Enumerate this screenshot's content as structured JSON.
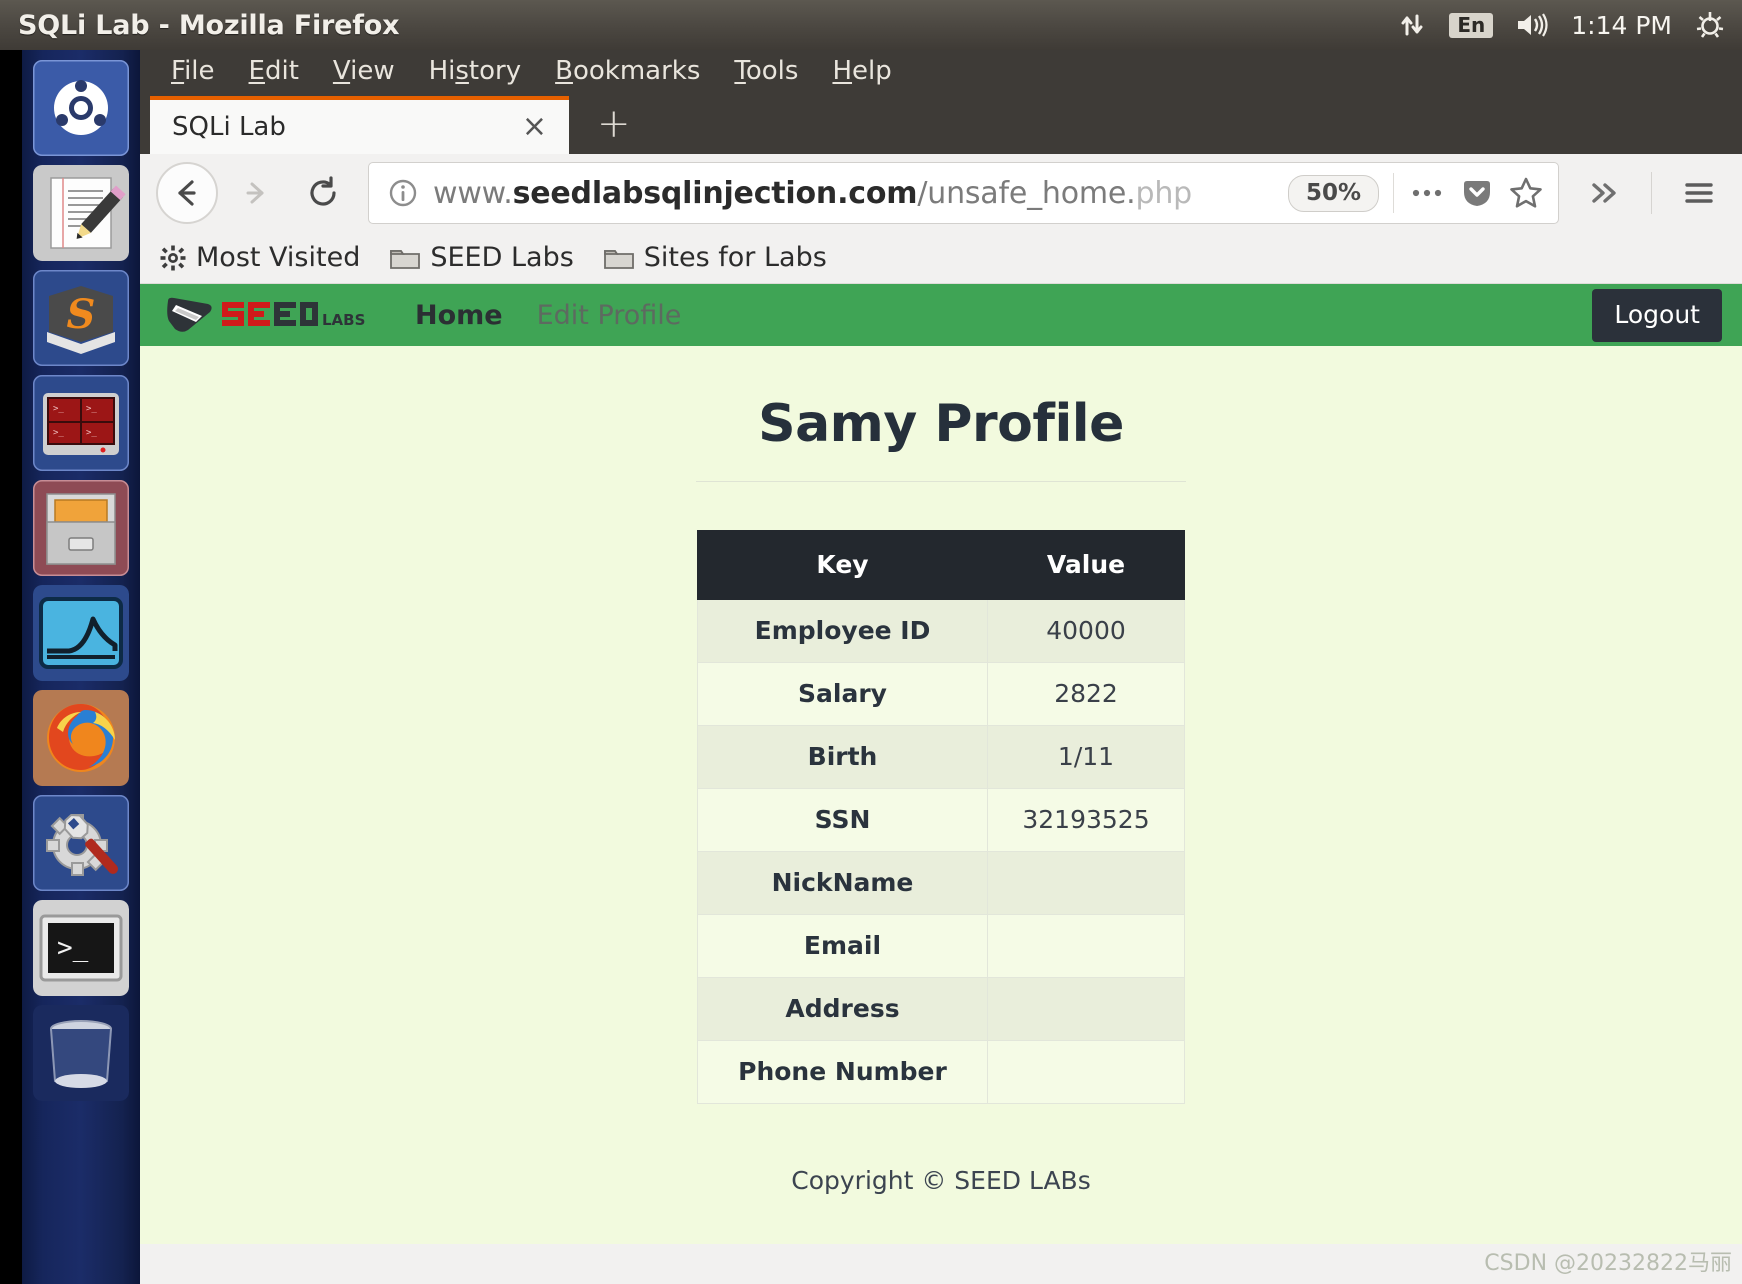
{
  "os_panel": {
    "window_title": "SQLi Lab - Mozilla Firefox",
    "keyboard_layout": "En",
    "clock": "1:14 PM",
    "icons": {
      "network": "network-updown-icon",
      "volume": "volume-icon",
      "session": "gear-power-icon"
    }
  },
  "launcher": {
    "items": [
      {
        "name": "ubuntu-dash-icon",
        "label": "Dash Home",
        "active": false
      },
      {
        "name": "text-editor-icon",
        "label": "Text Editor",
        "active": true
      },
      {
        "name": "sublime-text-icon",
        "label": "Sublime Text",
        "active": false
      },
      {
        "name": "terminator-icon",
        "label": "Terminator",
        "active": false
      },
      {
        "name": "file-manager-icon",
        "label": "Files",
        "active": true
      },
      {
        "name": "wireshark-icon",
        "label": "Wireshark",
        "active": false
      },
      {
        "name": "firefox-icon",
        "label": "Firefox Web Browser",
        "active": true,
        "focused": true
      },
      {
        "name": "system-settings-icon",
        "label": "System Settings",
        "active": false
      },
      {
        "name": "terminal-icon",
        "label": "Terminal",
        "active": true
      },
      {
        "name": "trash-icon",
        "label": "Trash",
        "active": false
      }
    ]
  },
  "browser": {
    "menubar": [
      {
        "label": "File",
        "accel": "F"
      },
      {
        "label": "Edit",
        "accel": "E"
      },
      {
        "label": "View",
        "accel": "V"
      },
      {
        "label": "History",
        "accel": "s"
      },
      {
        "label": "Bookmarks",
        "accel": "B"
      },
      {
        "label": "Tools",
        "accel": "T"
      },
      {
        "label": "Help",
        "accel": "H"
      }
    ],
    "tab": {
      "title": "SQLi Lab",
      "close_label": "×",
      "new_tab_label": "+"
    },
    "toolbar": {
      "back_label": "←",
      "forward_label": "→",
      "reload_label": "⟳",
      "url_prefix": "www.",
      "url_host": "seedlabsqlinjection.com",
      "url_path": "/unsafe_home.php",
      "url_full": "www.seedlabsqlinjection.com/unsafe_home.php",
      "zoom_level": "50%",
      "page_actions_label": "•••",
      "pocket_label": "Save to Pocket",
      "bookmark_label": "Bookmark this page",
      "overflow_label": "»",
      "menu_label": "Open menu"
    },
    "bookmarks": [
      {
        "icon": "gear-icon",
        "label": "Most Visited"
      },
      {
        "icon": "folder-icon",
        "label": "SEED Labs"
      },
      {
        "icon": "folder-icon",
        "label": "Sites for Labs"
      }
    ]
  },
  "site": {
    "brand": {
      "seed": "SEED",
      "labs": "LABS"
    },
    "nav": [
      {
        "label": "Home",
        "active": true
      },
      {
        "label": "Edit Profile",
        "active": false
      }
    ],
    "logout_label": "Logout",
    "accent_green": "#3fa455",
    "page_background": "#f2fade",
    "header_dark": "#23282e",
    "title": "Samy Profile",
    "table": {
      "headers": [
        "Key",
        "Value"
      ],
      "rows": [
        {
          "key": "Employee ID",
          "value": "40000"
        },
        {
          "key": "Salary",
          "value": "2822"
        },
        {
          "key": "Birth",
          "value": "1/11"
        },
        {
          "key": "SSN",
          "value": "32193525"
        },
        {
          "key": "NickName",
          "value": ""
        },
        {
          "key": "Email",
          "value": ""
        },
        {
          "key": "Address",
          "value": ""
        },
        {
          "key": "Phone Number",
          "value": ""
        }
      ]
    },
    "footer": "Copyright © SEED LABs"
  },
  "watermark": "CSDN @20232822马丽"
}
